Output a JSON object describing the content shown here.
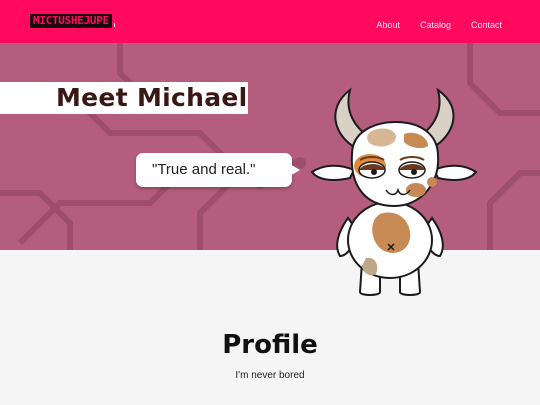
{
  "header": {
    "logo_text": "MICTUSHEJUPE",
    "nav": [
      "About",
      "Catalog",
      "Contact"
    ]
  },
  "hero": {
    "title": "Meet Michael",
    "quote": "\"True and real.\""
  },
  "profile": {
    "title": "Profile",
    "subtitle": "I'm never bored"
  },
  "colors": {
    "brand": "#ff0a5e",
    "hero_bg": "#b45d7d",
    "title_text": "#3a1714",
    "page_bg": "#f5f5f5"
  },
  "icons": {
    "mascot": "cow-mascot-illustration"
  }
}
